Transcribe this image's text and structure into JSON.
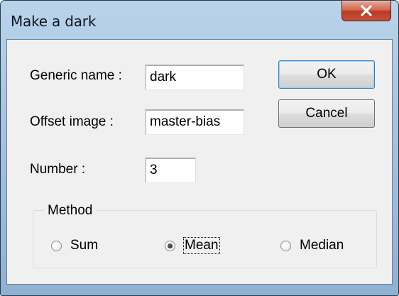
{
  "window": {
    "title": "Make a dark",
    "close_icon": "close-x-icon"
  },
  "form": {
    "generic_name": {
      "label": "Generic name :",
      "value": "dark"
    },
    "offset_image": {
      "label": "Offset image :",
      "value": "master-bias"
    },
    "number": {
      "label": "Number :",
      "value": "3"
    }
  },
  "buttons": {
    "ok_label": "OK",
    "cancel_label": "Cancel"
  },
  "method": {
    "legend": "Method",
    "options": [
      {
        "label": "Sum",
        "selected": false
      },
      {
        "label": "Mean",
        "selected": true
      },
      {
        "label": "Median",
        "selected": false
      }
    ]
  },
  "colors": {
    "title_bar": "#a7c5e2",
    "close_button": "#c8523a",
    "dialog_background": "#f0f0f0",
    "default_button_border": "#3c7fb1"
  }
}
